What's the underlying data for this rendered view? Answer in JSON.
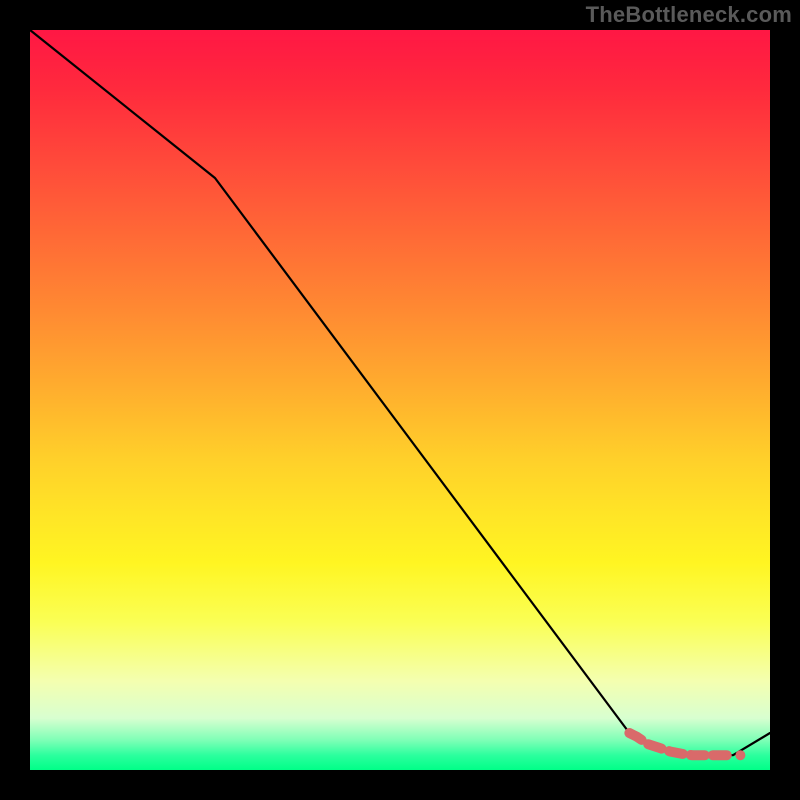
{
  "watermark": "TheBottleneck.com",
  "colors": {
    "black": "#000000",
    "line": "#000000",
    "marker": "#d96a6a",
    "gradient_top": "#ff1744",
    "gradient_yellow": "#fff522",
    "gradient_green": "#00ff88"
  },
  "chart_data": {
    "type": "line",
    "title": "",
    "xlabel": "",
    "ylabel": "",
    "xlim": [
      0,
      100
    ],
    "ylim": [
      0,
      100
    ],
    "grid": false,
    "series": [
      {
        "name": "bottleneck-curve",
        "x": [
          0,
          25,
          81,
          87,
          95,
          100
        ],
        "values": [
          100,
          80,
          5,
          2,
          2,
          5
        ]
      }
    ],
    "markers": {
      "name": "highlight-segment",
      "x": [
        81,
        82,
        83.5,
        85,
        86.5,
        88,
        89.5,
        91,
        92.5,
        95
      ],
      "values": [
        5,
        4.5,
        3.5,
        3,
        2.5,
        2.2,
        2.0,
        2.0,
        2.0,
        2.0
      ]
    }
  }
}
